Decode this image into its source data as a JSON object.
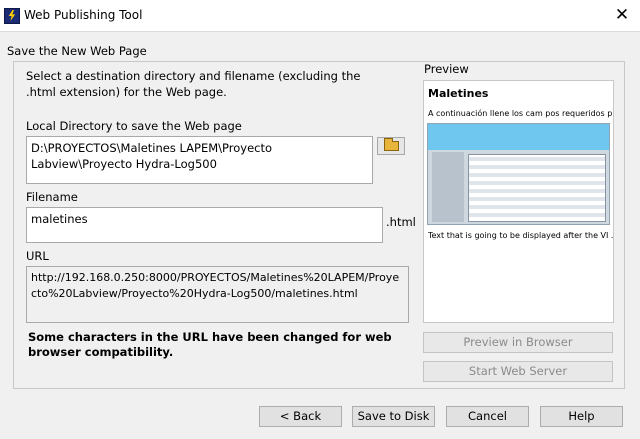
{
  "window": {
    "title": "Web Publishing Tool"
  },
  "group": {
    "caption": "Save the New Web Page"
  },
  "instructions": "Select a destination directory and filename (excluding the .html extension) for the Web page.",
  "local_directory": {
    "label": "Local Directory to save the Web page",
    "value": "D:\\PROYECTOS\\Maletines LAPEM\\Proyecto Labview\\Proyecto Hydra-Log500"
  },
  "filename": {
    "label": "Filename",
    "value": "maletines",
    "extension": ".html"
  },
  "url": {
    "label": "URL",
    "value": "http://192.168.0.250:8000/PROYECTOS/Maletines%20LAPEM/Proyecto%20Labview/Proyecto%20Hydra-Log500/maletines.html"
  },
  "compat_note": "Some characters in the URL have been changed for web browser compatibility.",
  "preview": {
    "caption": "Preview",
    "page_title": "Maletines",
    "description": "A continuación llene los cam pos requeridos p...",
    "footer": "Text that is going to be displayed after the VI ..."
  },
  "buttons": {
    "preview_in_browser": "Preview in Browser",
    "start_web_server": "Start Web Server",
    "back": "< Back",
    "save_to_disk": "Save to Disk",
    "cancel": "Cancel",
    "help": "Help"
  },
  "icons": {
    "close": "✕",
    "app": "labview-icon",
    "browse": "folder-icon"
  },
  "colors": {
    "preview_banner": "#6fc7ef",
    "app_icon_bg": "#1c2c74",
    "app_icon_bolt": "#ffcc00"
  }
}
